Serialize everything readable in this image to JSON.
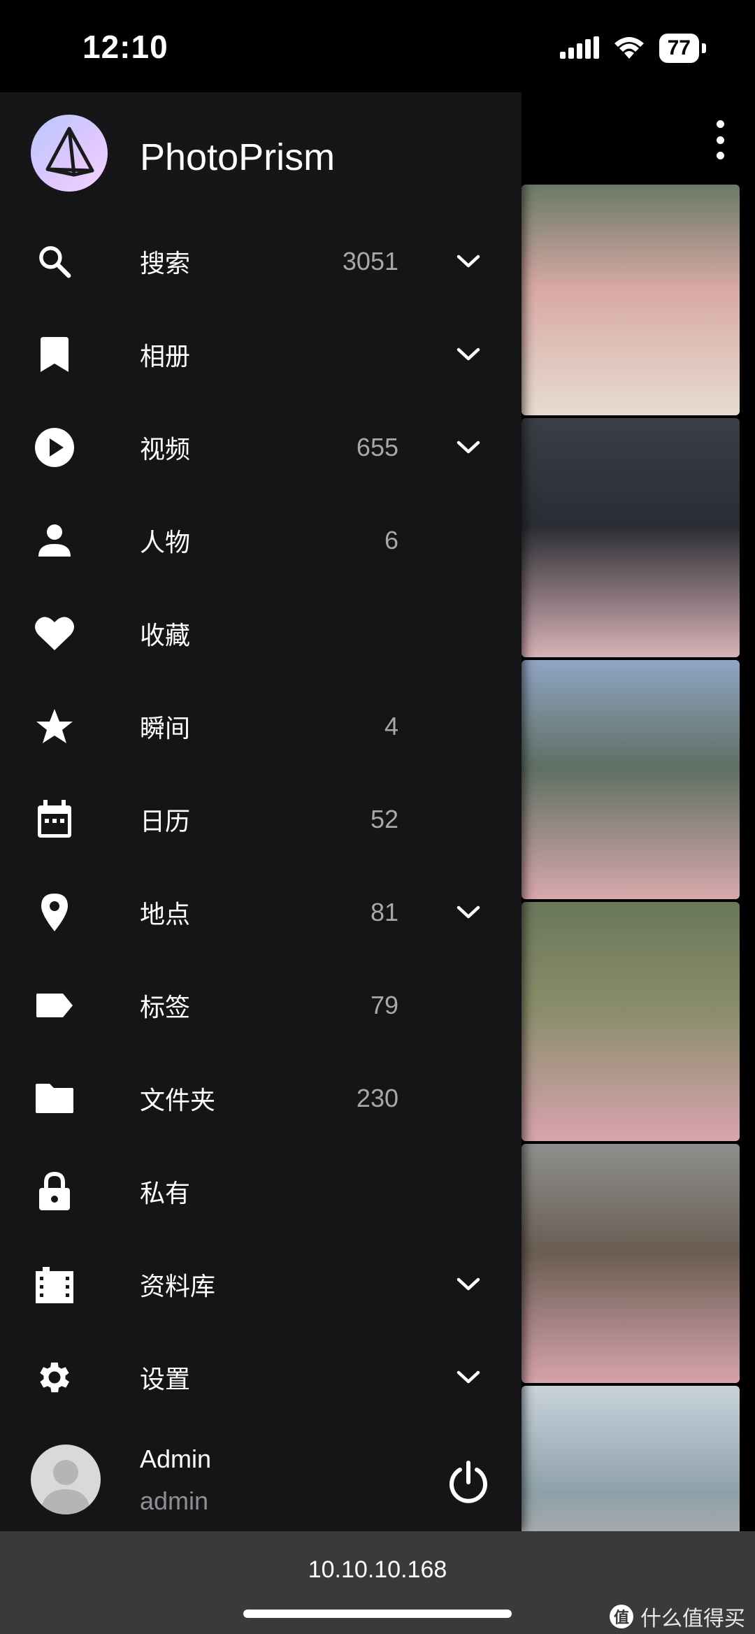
{
  "status_bar": {
    "time": "12:10",
    "battery": "77"
  },
  "header": {
    "app_title": "PhotoPrism"
  },
  "nav": [
    {
      "label": "搜索",
      "count": "3051",
      "icon": "search-icon",
      "expandable": true
    },
    {
      "label": "相册",
      "count": "",
      "icon": "bookmark-icon",
      "expandable": true
    },
    {
      "label": "视频",
      "count": "655",
      "icon": "play-circle-icon",
      "expandable": true
    },
    {
      "label": "人物",
      "count": "6",
      "icon": "person-icon",
      "expandable": false
    },
    {
      "label": "收藏",
      "count": "",
      "icon": "heart-icon",
      "expandable": false
    },
    {
      "label": "瞬间",
      "count": "4",
      "icon": "star-icon",
      "expandable": false
    },
    {
      "label": "日历",
      "count": "52",
      "icon": "calendar-icon",
      "expandable": false
    },
    {
      "label": "地点",
      "count": "81",
      "icon": "place-pin-icon",
      "expandable": true
    },
    {
      "label": "标签",
      "count": "79",
      "icon": "label-tag-icon",
      "expandable": false
    },
    {
      "label": "文件夹",
      "count": "230",
      "icon": "folder-icon",
      "expandable": false
    },
    {
      "label": "私有",
      "count": "",
      "icon": "lock-icon",
      "expandable": false
    },
    {
      "label": "资料库",
      "count": "",
      "icon": "film-library-icon",
      "expandable": true
    },
    {
      "label": "设置",
      "count": "",
      "icon": "gear-icon",
      "expandable": true
    }
  ],
  "user": {
    "name": "Admin",
    "login": "admin"
  },
  "browser": {
    "url": "10.10.10.168"
  },
  "watermark": {
    "text": "什么值得买",
    "mark": "值"
  },
  "thumbnails": [
    {
      "colors": [
        "#6a7a66",
        "#d8a9a4",
        "#e7dccf"
      ]
    },
    {
      "colors": [
        "#3b3f45",
        "#2a2d33",
        "#d8b2b8"
      ]
    },
    {
      "colors": [
        "#8fa5c4",
        "#5f6f63",
        "#d9a8ab"
      ]
    },
    {
      "colors": [
        "#6a775a",
        "#8a8d6b",
        "#d8a4ae"
      ]
    },
    {
      "colors": [
        "#8d8f8d",
        "#6a5d52",
        "#d6a3ab"
      ]
    },
    {
      "colors": [
        "#c9d3dc",
        "#8da0a8",
        "#e4c3b6"
      ]
    }
  ],
  "colors": {
    "drawer_bg": "#151517",
    "count_text": "#a8a8ab",
    "bottom_bar": "#3a3a3c"
  }
}
